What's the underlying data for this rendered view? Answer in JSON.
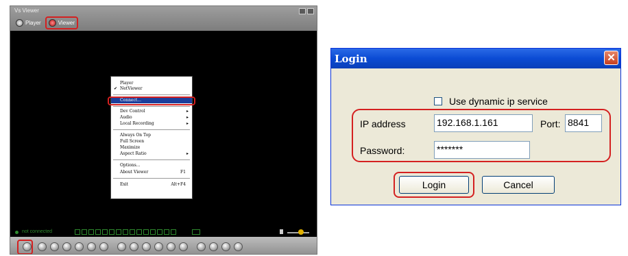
{
  "viewer": {
    "title": "Vs Viewer",
    "tabs": [
      {
        "label": "Player",
        "icon": "player-icon"
      },
      {
        "label": "Viewer",
        "icon": "viewer-icon"
      }
    ],
    "context_menu": {
      "items": [
        {
          "label": "Player"
        },
        {
          "label": "NetViewer",
          "checked": true
        },
        {
          "label": "Connect...",
          "highlighted": true
        },
        {
          "label": "Dev Control",
          "submenu": true
        },
        {
          "label": "Audio",
          "submenu": true
        },
        {
          "label": "Local Recording",
          "submenu": true
        },
        {
          "label": "Always On Top"
        },
        {
          "label": "Full Screen"
        },
        {
          "label": "Maximize"
        },
        {
          "label": "Aspect Ratio",
          "submenu": true
        },
        {
          "label": "Options..."
        },
        {
          "label": "About Viewer",
          "shortcut": "F1"
        },
        {
          "label": "Exit",
          "shortcut": "Alt+F4"
        }
      ]
    },
    "status": {
      "text": "not connected"
    },
    "highlight_color": "#d42020"
  },
  "login": {
    "title": "Login",
    "dynamic_ip_label": "Use dynamic ip service",
    "ip_label": "IP address",
    "ip_value": "192.168.1.161",
    "port_label": "Port:",
    "port_value": "8841",
    "password_label": "Password:",
    "password_value": "*******",
    "login_button": "Login",
    "cancel_button": "Cancel",
    "title_color": "#0b4bd4"
  }
}
